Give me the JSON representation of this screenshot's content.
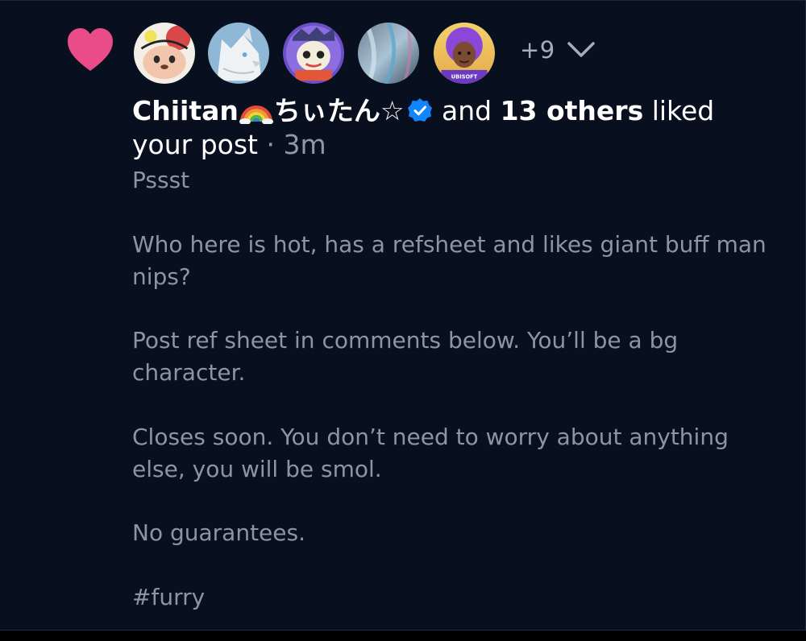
{
  "notification": {
    "more_count": "+9",
    "headline": {
      "name": "Chiitan",
      "name_suffix": "ちぃたん☆",
      "joiner": "and",
      "others": "13 others",
      "action": "liked your post",
      "separator": "·",
      "time": "3m"
    },
    "avatars": [
      {
        "icon": "cartoon-animal-avatar-1"
      },
      {
        "icon": "white-wolf-avatar"
      },
      {
        "icon": "cartoon-animal-avatar-2"
      },
      {
        "icon": "abstract-blue-avatar"
      },
      {
        "icon": "ubisoft-character-avatar",
        "caption": "UBISOFT"
      }
    ],
    "post": {
      "paragraphs": [
        "Pssst",
        "Who here is hot, has a refsheet and likes giant buff man nips?",
        "Post ref sheet in comments below. You’ll be a bg character.",
        "Closes soon. You don’t need to worry about anything else, you will be smol.",
        "No guarantees.",
        "#furry"
      ]
    }
  },
  "colors": {
    "background": "#08101f",
    "heart": "#ea4c89",
    "verified_badge": "#1185fe",
    "text_primary": "#ffffff",
    "text_secondary": "#8b95a5"
  }
}
